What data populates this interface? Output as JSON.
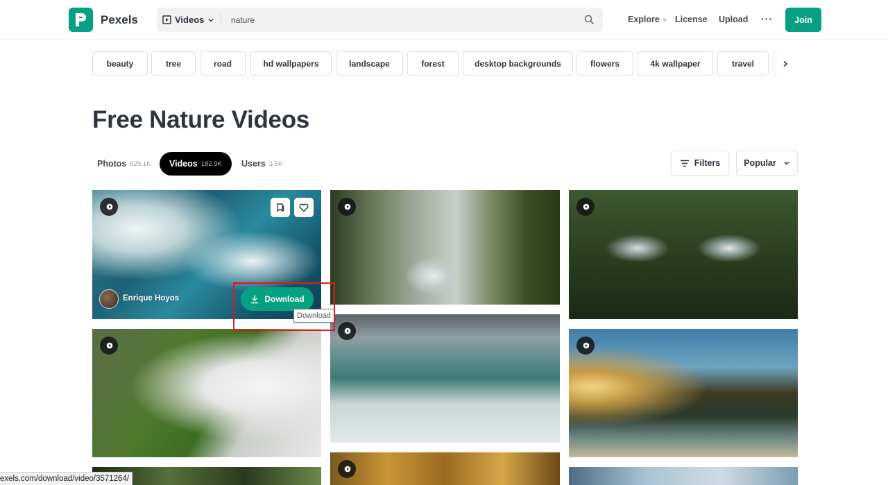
{
  "header": {
    "brand": "Pexels",
    "search_type": "Videos",
    "search_value": "nature",
    "nav": [
      "Explore",
      "License",
      "Upload"
    ],
    "more": "···",
    "join": "Join"
  },
  "tags": [
    "beauty",
    "tree",
    "road",
    "hd wallpapers",
    "landscape",
    "forest",
    "desktop backgrounds",
    "flowers",
    "4k wallpaper",
    "travel"
  ],
  "page_title": "Free Nature Videos",
  "tabs": [
    {
      "label": "Photos",
      "count": "629.1K"
    },
    {
      "label": "Videos",
      "count": "182.9K"
    },
    {
      "label": "Users",
      "count": "3.5K"
    }
  ],
  "filters_label": "Filters",
  "sort_label": "Popular",
  "featured_card": {
    "author": "Enrique Hoyos",
    "download_label": "Download"
  },
  "tooltip": "Download",
  "status_url": "exels.com/download/video/3571264/",
  "colors": {
    "brand_green": "#07a081",
    "highlight_red": "#e0181f"
  }
}
